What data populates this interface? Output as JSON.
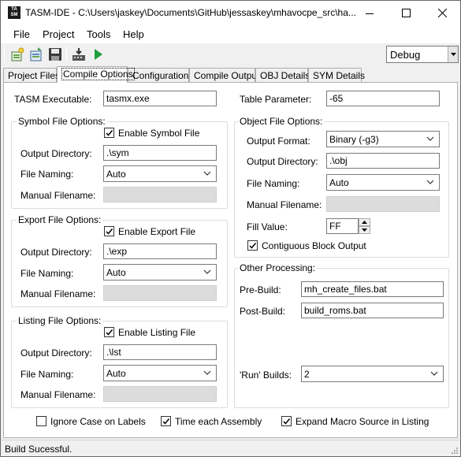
{
  "window": {
    "title": "TASM-IDE - C:\\Users\\jaskey\\Documents\\GitHub\\jessaskey\\mhavocpe_src\\ha...",
    "icon_label_top": "TA",
    "icon_label_bottom": "SM"
  },
  "menu": {
    "file": "File",
    "project": "Project",
    "tools": "Tools",
    "help": "Help"
  },
  "toolbar": {
    "icons": [
      "new-project-icon",
      "open-project-icon",
      "save-icon",
      "build-icon",
      "run-icon"
    ],
    "configuration_selected": "Debug"
  },
  "tabs": [
    {
      "label": "Project Files"
    },
    {
      "label": "Compile Options"
    },
    {
      "label": "Configurations"
    },
    {
      "label": "Compile Output"
    },
    {
      "label": "OBJ Details"
    },
    {
      "label": "SYM Details"
    }
  ],
  "compile": {
    "tasm_executable_label": "TASM Executable:",
    "tasm_executable_value": "tasmx.exe",
    "table_parameter_label": "Table Parameter:",
    "table_parameter_value": "-65",
    "symbol": {
      "group_title": "Symbol File Options:",
      "enable_label": "Enable Symbol File",
      "enable_checked": true,
      "output_dir_label": "Output Directory:",
      "output_dir_value": ".\\sym",
      "naming_label": "File Naming:",
      "naming_value": "Auto",
      "manual_label": "Manual Filename:",
      "manual_value": ""
    },
    "export": {
      "group_title": "Export File Options:",
      "enable_label": "Enable Export File",
      "enable_checked": true,
      "output_dir_label": "Output Directory:",
      "output_dir_value": ".\\exp",
      "naming_label": "File Naming:",
      "naming_value": "Auto",
      "manual_label": "Manual Filename:",
      "manual_value": ""
    },
    "listing": {
      "group_title": "Listing File Options:",
      "enable_label": "Enable Listing File",
      "enable_checked": true,
      "output_dir_label": "Output Directory:",
      "output_dir_value": ".\\lst",
      "naming_label": "File Naming:",
      "naming_value": "Auto",
      "manual_label": "Manual Filename:",
      "manual_value": ""
    },
    "object": {
      "group_title": "Object File Options:",
      "format_label": "Output Format:",
      "format_value": "Binary (-g3)",
      "output_dir_label": "Output Directory:",
      "output_dir_value": ".\\obj",
      "naming_label": "File Naming:",
      "naming_value": "Auto",
      "manual_label": "Manual Filename:",
      "manual_value": "",
      "fill_label": "Fill Value:",
      "fill_value": "FF",
      "contiguous_label": "Contiguous Block Output",
      "contiguous_checked": true
    },
    "other": {
      "group_title": "Other Processing:",
      "prebuild_label": "Pre-Build:",
      "prebuild_value": "mh_create_files.bat",
      "postbuild_label": "Post-Build:",
      "postbuild_value": "build_roms.bat",
      "run_builds_label": "'Run' Builds:",
      "run_builds_value": "2"
    },
    "options": {
      "ignore_case_label": "Ignore Case on Labels",
      "ignore_case_checked": false,
      "time_assembly_label": "Time each Assembly",
      "time_assembly_checked": true,
      "expand_macro_label": "Expand Macro Source in Listing",
      "expand_macro_checked": true
    }
  },
  "status": {
    "text": "Build Sucessful."
  }
}
